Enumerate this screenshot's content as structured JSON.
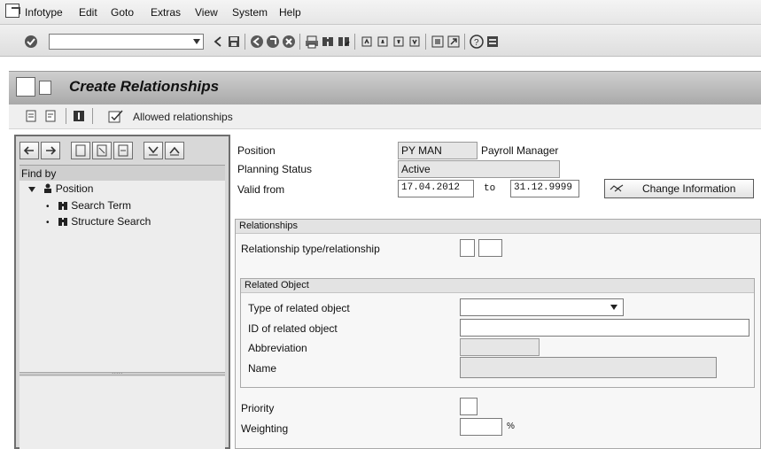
{
  "menubar": {
    "items": [
      "Infotype",
      "Edit",
      "Goto",
      "Extras",
      "View",
      "System",
      "Help"
    ]
  },
  "toolbar": {
    "command_field": {
      "value": "",
      "placeholder": ""
    }
  },
  "title": {
    "text": "Create Relationships"
  },
  "app_toolbar": {
    "allowed_relationships_label": "Allowed relationships"
  },
  "left_pane": {
    "find_by_label": "Find by",
    "tree": [
      {
        "label": "Position"
      },
      {
        "label": "Search Term"
      },
      {
        "label": "Structure Search"
      }
    ],
    "splitter_dots": "....."
  },
  "header": {
    "position": {
      "label": "Position",
      "abbr": "PY MAN",
      "name": "Payroll Manager"
    },
    "planning_status": {
      "label": "Planning Status",
      "value": "Active"
    },
    "valid_from": {
      "label": "Valid from",
      "from": "17.04.2012",
      "to_label": "to",
      "to": "31.12.9999"
    },
    "change_info_button": "Change Information"
  },
  "relationships": {
    "title": "Relationships",
    "rel_type_label": "Relationship type/relationship"
  },
  "related_object": {
    "title": "Related Object",
    "type_label": "Type of related object",
    "id_label": "ID of related object",
    "abbr_label": "Abbreviation",
    "name_label": "Name"
  },
  "priority": {
    "label": "Priority"
  },
  "weighting": {
    "label": "Weighting",
    "unit": "%"
  }
}
